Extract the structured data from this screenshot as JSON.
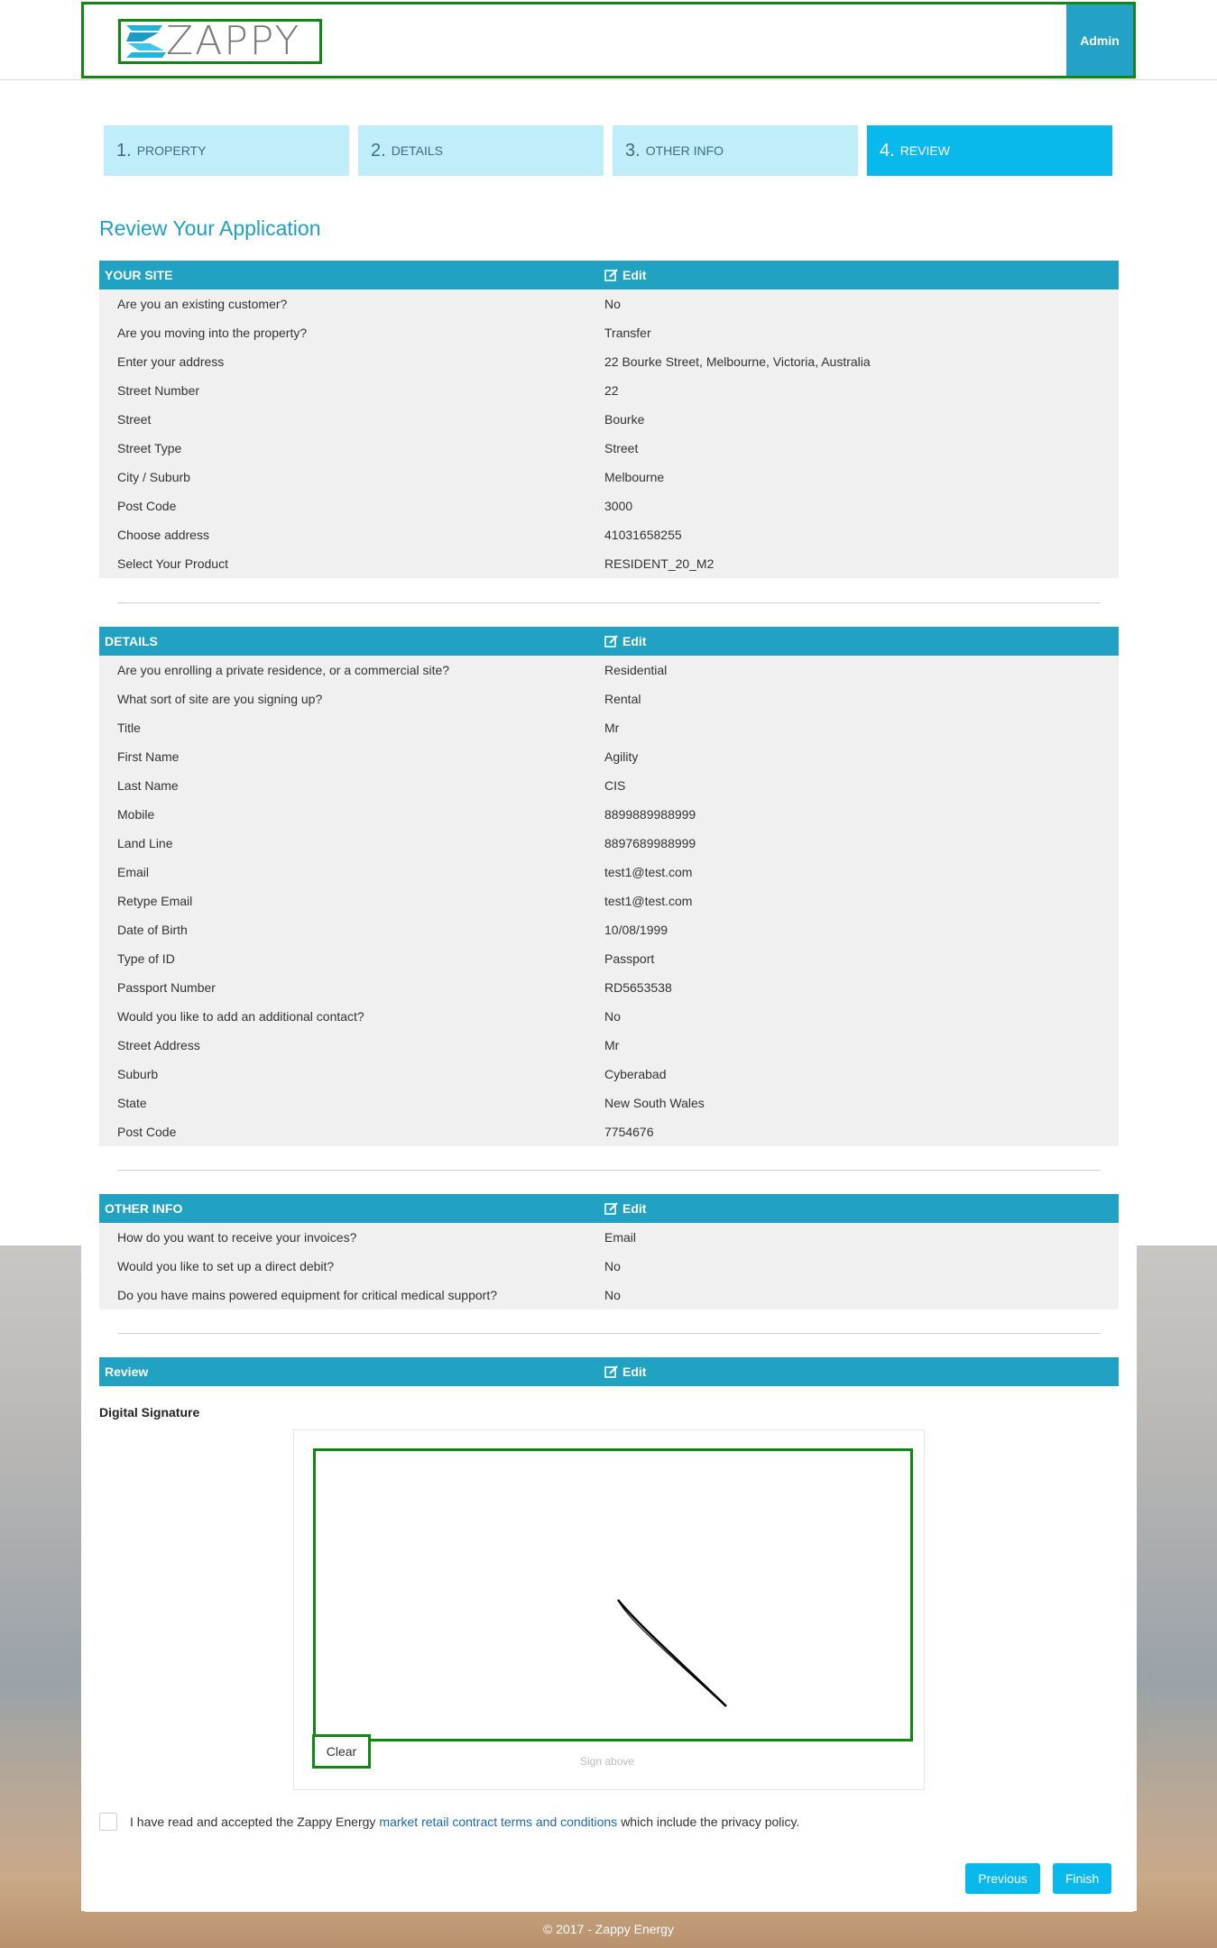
{
  "header": {
    "logo_text": "ZAPPY",
    "admin_label": "Admin"
  },
  "steps": [
    {
      "num": "1.",
      "label": "PROPERTY"
    },
    {
      "num": "2.",
      "label": "DETAILS"
    },
    {
      "num": "3.",
      "label": "OTHER INFO"
    },
    {
      "num": "4.",
      "label": "REVIEW"
    }
  ],
  "page_title": "Review Your Application",
  "edit_label": "Edit",
  "sections": {
    "your_site": {
      "title": "YOUR SITE",
      "rows": [
        {
          "q": "Are you an existing customer?",
          "a": "No"
        },
        {
          "q": "Are you moving into the property?",
          "a": "Transfer"
        },
        {
          "q": "Enter your address",
          "a": "22 Bourke Street, Melbourne, Victoria, Australia"
        },
        {
          "q": "Street Number",
          "a": "22"
        },
        {
          "q": "Street",
          "a": "Bourke"
        },
        {
          "q": "Street Type",
          "a": "Street"
        },
        {
          "q": "City / Suburb",
          "a": "Melbourne"
        },
        {
          "q": "Post Code",
          "a": "3000"
        },
        {
          "q": "Choose address",
          "a": "41031658255"
        },
        {
          "q": "Select Your Product",
          "a": "RESIDENT_20_M2"
        }
      ]
    },
    "details": {
      "title": "DETAILS",
      "rows": [
        {
          "q": "Are you enrolling a private residence, or a commercial site?",
          "a": "Residential"
        },
        {
          "q": "What sort of site are you signing up?",
          "a": "Rental"
        },
        {
          "q": "Title",
          "a": "Mr"
        },
        {
          "q": "First Name",
          "a": "Agility"
        },
        {
          "q": "Last Name",
          "a": "CIS"
        },
        {
          "q": "Mobile",
          "a": "8899889988999"
        },
        {
          "q": "Land Line",
          "a": "8897689988999"
        },
        {
          "q": "Email",
          "a": "test1@test.com"
        },
        {
          "q": "Retype Email",
          "a": "test1@test.com"
        },
        {
          "q": "Date of Birth",
          "a": "10/08/1999"
        },
        {
          "q": "Type of ID",
          "a": "Passport"
        },
        {
          "q": "Passport Number",
          "a": "RD5653538"
        },
        {
          "q": "Would you like to add an additional contact?",
          "a": "No"
        },
        {
          "q": "Street Address",
          "a": "Mr"
        },
        {
          "q": "Suburb",
          "a": "Cyberabad"
        },
        {
          "q": "State",
          "a": "New South Wales"
        },
        {
          "q": "Post Code",
          "a": "7754676"
        }
      ]
    },
    "other_info": {
      "title": "OTHER INFO",
      "rows": [
        {
          "q": "How do you want to receive your invoices?",
          "a": "Email"
        },
        {
          "q": "Would you like to set up a direct debit?",
          "a": "No"
        },
        {
          "q": "Do you have mains powered equipment for critical medical support?",
          "a": "No"
        }
      ]
    },
    "review": {
      "title": "Review"
    }
  },
  "signature": {
    "label": "Digital Signature",
    "clear_label": "Clear",
    "hint": "Sign above"
  },
  "terms": {
    "prefix": "I have read and accepted the Zappy Energy",
    "link": "market retail contract terms and conditions",
    "suffix": "which include the privacy policy."
  },
  "buttons": {
    "previous": "Previous",
    "finish": "Finish"
  },
  "footer": "© 2017 - Zappy Energy",
  "colors": {
    "accent": "#22a2c2",
    "step_inactive": "#bfedfa",
    "step_active": "#0ab9ec",
    "highlight_border": "#118811"
  }
}
